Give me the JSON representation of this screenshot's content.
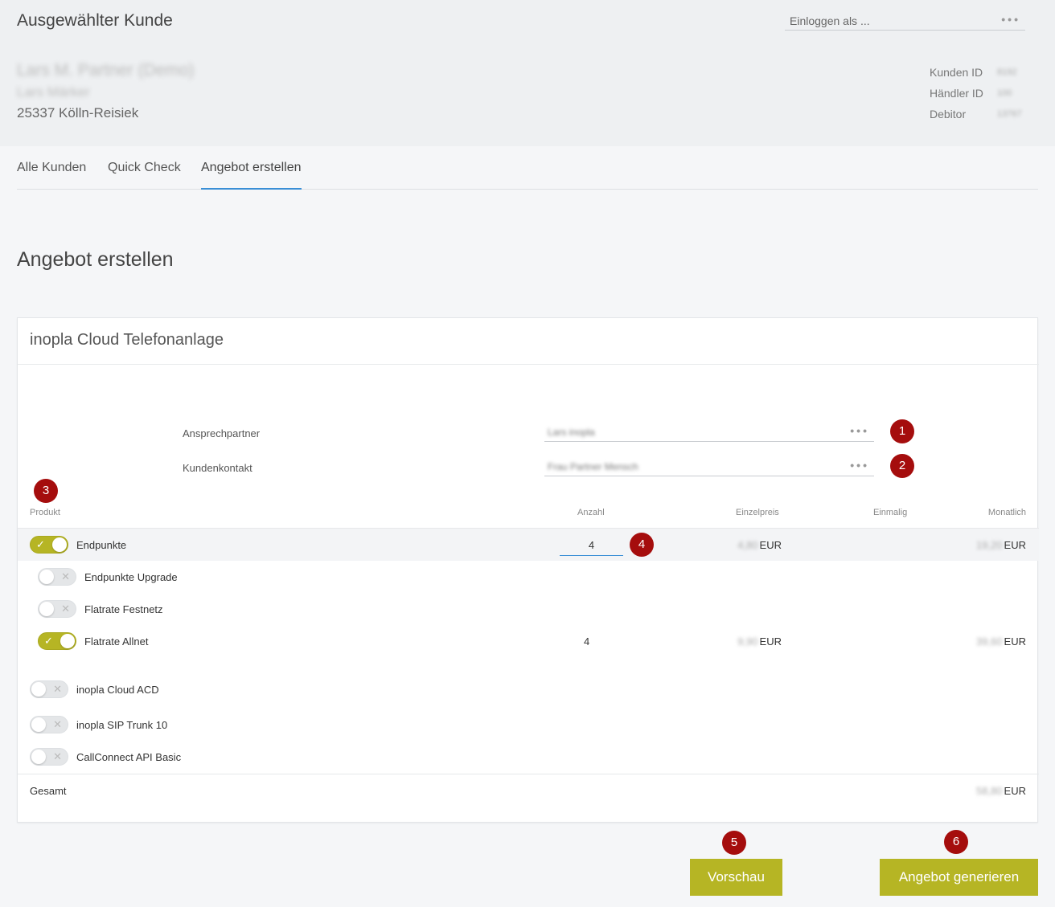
{
  "header": {
    "title": "Ausgewählter Kunde",
    "login_placeholder": "Einloggen als ...",
    "dots": "•••",
    "customer_name": "Lars M. Partner (Demo)",
    "customer_sub": "Lars Märker",
    "customer_city": "25337 Kölln-Reisiek",
    "meta": [
      {
        "label": "Kunden ID",
        "value": "8192"
      },
      {
        "label": "Händler ID",
        "value": "100"
      },
      {
        "label": "Debitor",
        "value": "13767"
      }
    ]
  },
  "tabs": [
    {
      "label": "Alle Kunden"
    },
    {
      "label": "Quick Check"
    },
    {
      "label": "Angebot erstellen"
    }
  ],
  "page_title": "Angebot erstellen",
  "card": {
    "title": "inopla Cloud Telefonanlage",
    "fields": [
      {
        "label": "Ansprechpartner",
        "value": "Lars inopla"
      },
      {
        "label": "Kundenkontakt",
        "value": "Frau Partner Mensch"
      }
    ],
    "columns": {
      "product": "Produkt",
      "qty": "Anzahl",
      "unit_price": "Einzelpreis",
      "one_time": "Einmalig",
      "monthly": "Monatlich"
    },
    "products": [
      {
        "label": "Endpunkte",
        "on": true,
        "qty": "4",
        "unit_price": "4,80",
        "monthly": "19,20",
        "currency": "EUR"
      },
      {
        "label": "Endpunkte Upgrade",
        "on": false
      },
      {
        "label": "Flatrate Festnetz",
        "on": false
      },
      {
        "label": "Flatrate Allnet",
        "on": true,
        "qty": "4",
        "unit_price": "9,90",
        "monthly": "39,60",
        "currency": "EUR"
      },
      {
        "label": "inopla Cloud ACD",
        "on": false
      },
      {
        "label": "inopla SIP Trunk 10",
        "on": false
      },
      {
        "label": "CallConnect API Basic",
        "on": false
      }
    ],
    "total": {
      "label": "Gesamt",
      "value": "58,80",
      "currency": "EUR"
    }
  },
  "badges": [
    "1",
    "2",
    "3",
    "4",
    "5",
    "6"
  ],
  "buttons": {
    "preview": "Vorschau",
    "generate": "Angebot generieren"
  },
  "colors": {
    "accent": "#b6b524",
    "badge": "#a50d0d",
    "tab_active": "#3a8fd6"
  },
  "icons": {
    "toggle_on": "check-icon",
    "toggle_off": "x-icon"
  }
}
